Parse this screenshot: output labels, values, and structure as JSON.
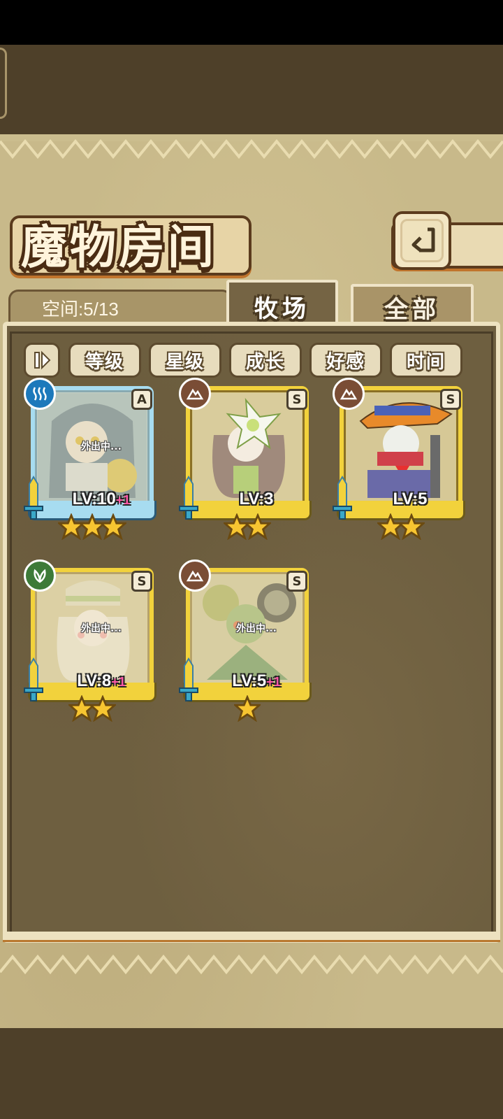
{
  "header": {
    "title": "魔物房间",
    "back_icon": "back-arrow-icon"
  },
  "tabs": {
    "space_label": "空间:5/13",
    "ranch": "牧场",
    "all": "全部",
    "active": "ranch"
  },
  "sort": {
    "toggle_icon": "sort-order-icon",
    "level": "等级",
    "stars": "星级",
    "growth": "成长",
    "affection": "好感",
    "time": "时间"
  },
  "monsters": [
    {
      "element": "water",
      "rank": "A",
      "level": "LV:10",
      "bonus": "+1",
      "status": "外出中...",
      "stars": 3,
      "frame": "blue"
    },
    {
      "element": "earth",
      "rank": "S",
      "level": "LV:3",
      "bonus": "",
      "status": "",
      "stars": 2,
      "frame": "gold"
    },
    {
      "element": "earth",
      "rank": "S",
      "level": "LV:5",
      "bonus": "",
      "status": "",
      "stars": 2,
      "frame": "gold"
    },
    {
      "element": "grass",
      "rank": "S",
      "level": "LV:8",
      "bonus": "+1",
      "status": "外出中...",
      "stars": 2,
      "frame": "gold"
    },
    {
      "element": "earth",
      "rank": "S",
      "level": "LV:5",
      "bonus": "+1",
      "status": "外出中...",
      "stars": 1,
      "frame": "gold"
    }
  ],
  "colors": {
    "gold_frame": "#f2d23c",
    "blue_frame": "#a7dcf0",
    "panel_border": "#ede2c0",
    "bonus_pink": "#ff5aa8"
  }
}
